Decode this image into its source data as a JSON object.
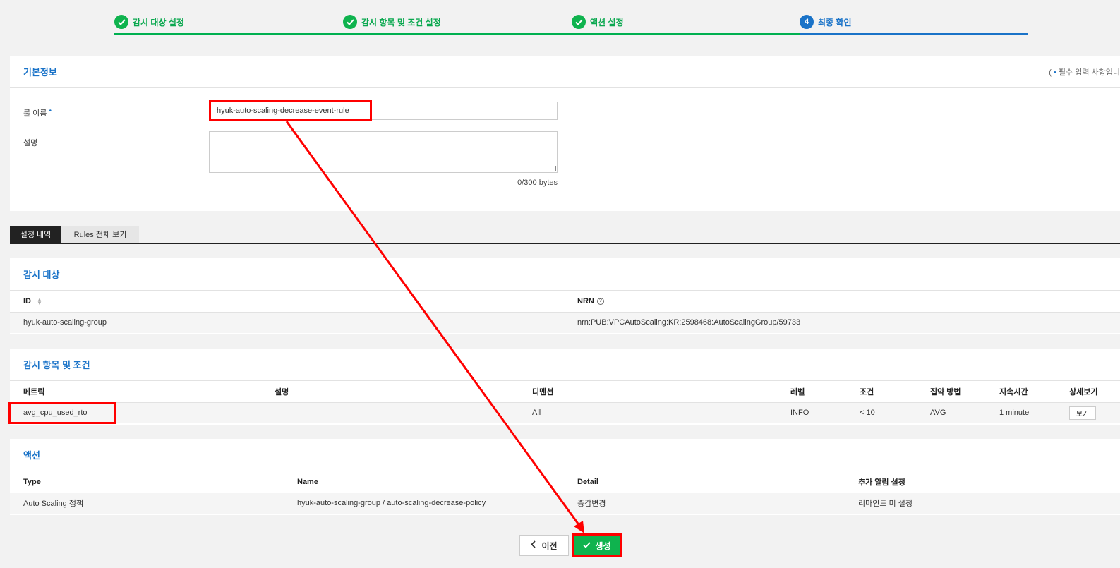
{
  "steps": [
    {
      "label": "감시 대상 설정",
      "state": "done"
    },
    {
      "label": "감시 항목 및 조건 설정",
      "state": "done"
    },
    {
      "label": "액션 설정",
      "state": "done"
    },
    {
      "label": "최종 확인",
      "state": "current",
      "number": "4"
    }
  ],
  "basic": {
    "title": "기본정보",
    "required_note_open": "( ",
    "required_note_bullet": "•",
    "required_note_text": " 필수 입력 사항입니",
    "rule_name_label": "룰 이름",
    "required_dot": "•",
    "rule_name_value": "hyuk-auto-scaling-decrease-event-rule",
    "description_label": "설명",
    "bytes": "0/300 bytes"
  },
  "tabs": {
    "active": "설정 내역",
    "other": "Rules 전체 보기"
  },
  "target": {
    "title": "감시 대상",
    "headers": {
      "id": "ID",
      "nrn": "NRN"
    },
    "row": {
      "id": "hyuk-auto-scaling-group",
      "nrn": "nrn:PUB:VPCAutoScaling:KR:2598468:AutoScalingGroup/59733"
    }
  },
  "conditions": {
    "title": "감시 항목 및 조건",
    "headers": [
      "메트릭",
      "설명",
      "디멘션",
      "레벨",
      "조건",
      "집약 방법",
      "지속시간",
      "상세보기"
    ],
    "row": {
      "metric": "avg_cpu_used_rto",
      "description": "",
      "dimension": "All",
      "level": "INFO",
      "condition": "< 10",
      "aggregation": "AVG",
      "duration": "1 minute",
      "view": "보기"
    }
  },
  "action": {
    "title": "액션",
    "headers": [
      "Type",
      "Name",
      "Detail",
      "추가 알림 설정"
    ],
    "row": {
      "type": "Auto Scaling 정책",
      "name": "hyuk-auto-scaling-group / auto-scaling-decrease-policy",
      "detail": "증감변경",
      "notification": "리마인드 미 설정"
    }
  },
  "buttons": {
    "prev": "이전",
    "create": "생성"
  },
  "colors": {
    "accent": "#1a73c8",
    "success": "#0fb34e",
    "annotation": "#ff0000"
  }
}
